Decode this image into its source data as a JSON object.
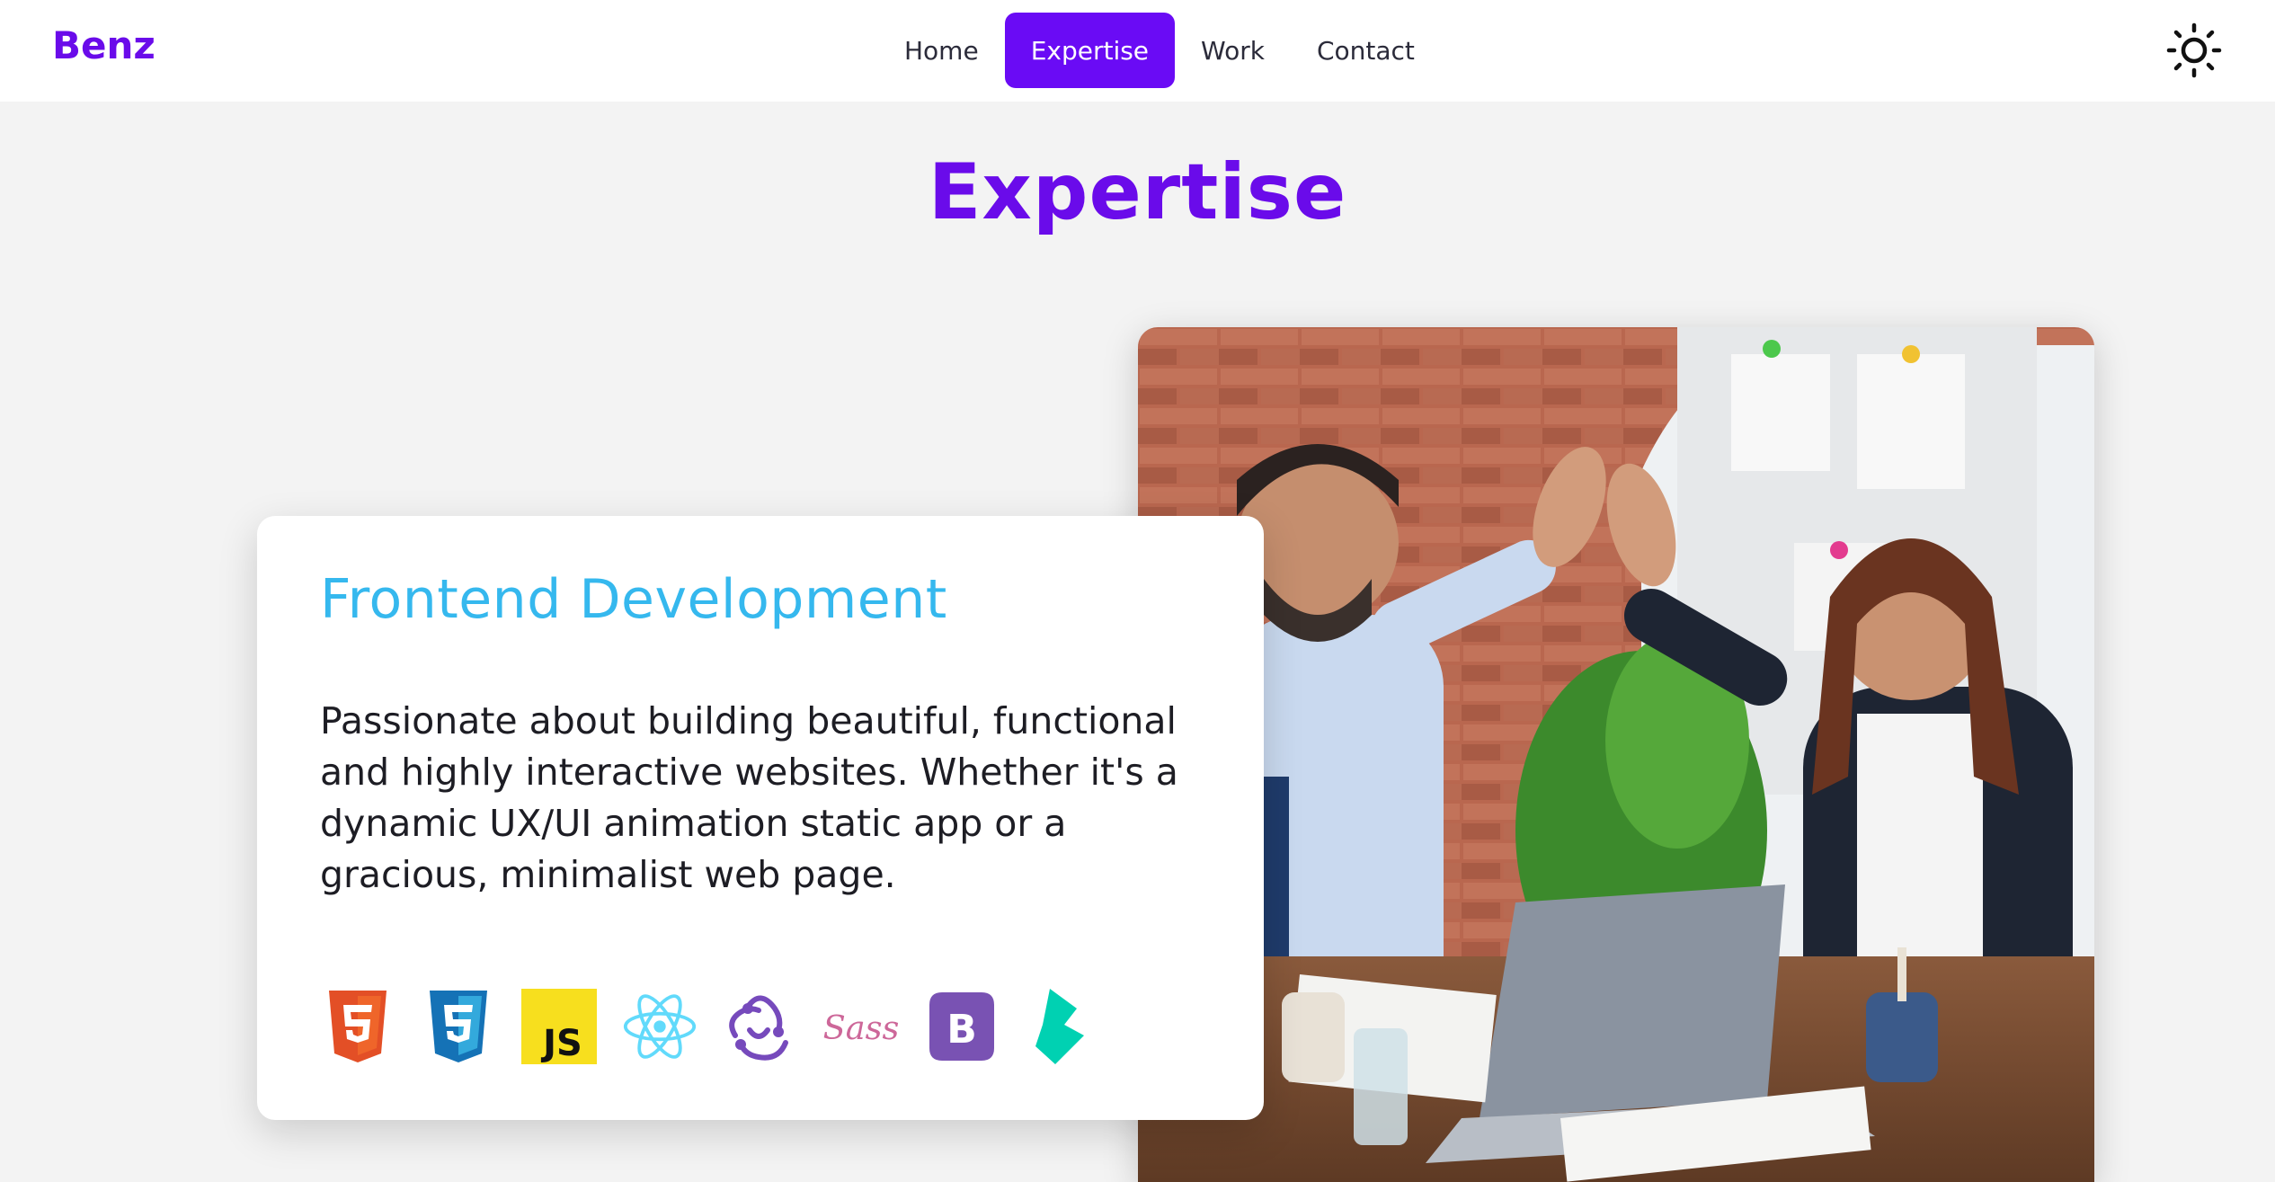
{
  "nav": {
    "brand": "Benz",
    "links": [
      {
        "label": "Home",
        "active": false
      },
      {
        "label": "Expertise",
        "active": true
      },
      {
        "label": "Work",
        "active": false
      },
      {
        "label": "Contact",
        "active": false
      }
    ],
    "theme_icon": "sun-icon"
  },
  "section": {
    "title": "Expertise"
  },
  "card": {
    "title": "Frontend Development",
    "description": "Passionate about building beautiful, functional and highly interactive websites. Whether it's a dynamic UX/UI animation static app or a gracious, minimalist web page.",
    "tech_icons": [
      {
        "name": "html5-icon",
        "color": "#e34f26"
      },
      {
        "name": "css3-icon",
        "color": "#1572b6"
      },
      {
        "name": "javascript-icon",
        "color": "#f7df1e",
        "text": "JS"
      },
      {
        "name": "react-icon",
        "color": "#61dafb"
      },
      {
        "name": "redux-icon",
        "color": "#764abc"
      },
      {
        "name": "sass-icon",
        "color": "#cd6799",
        "text": "Sass"
      },
      {
        "name": "bootstrap-icon",
        "color": "#7952b3",
        "text": "B"
      },
      {
        "name": "bulma-icon",
        "color": "#00d1b2"
      }
    ]
  },
  "colors": {
    "accent": "#6a0bea",
    "card_title": "#35b8ee",
    "background": "#f3f3f3"
  }
}
